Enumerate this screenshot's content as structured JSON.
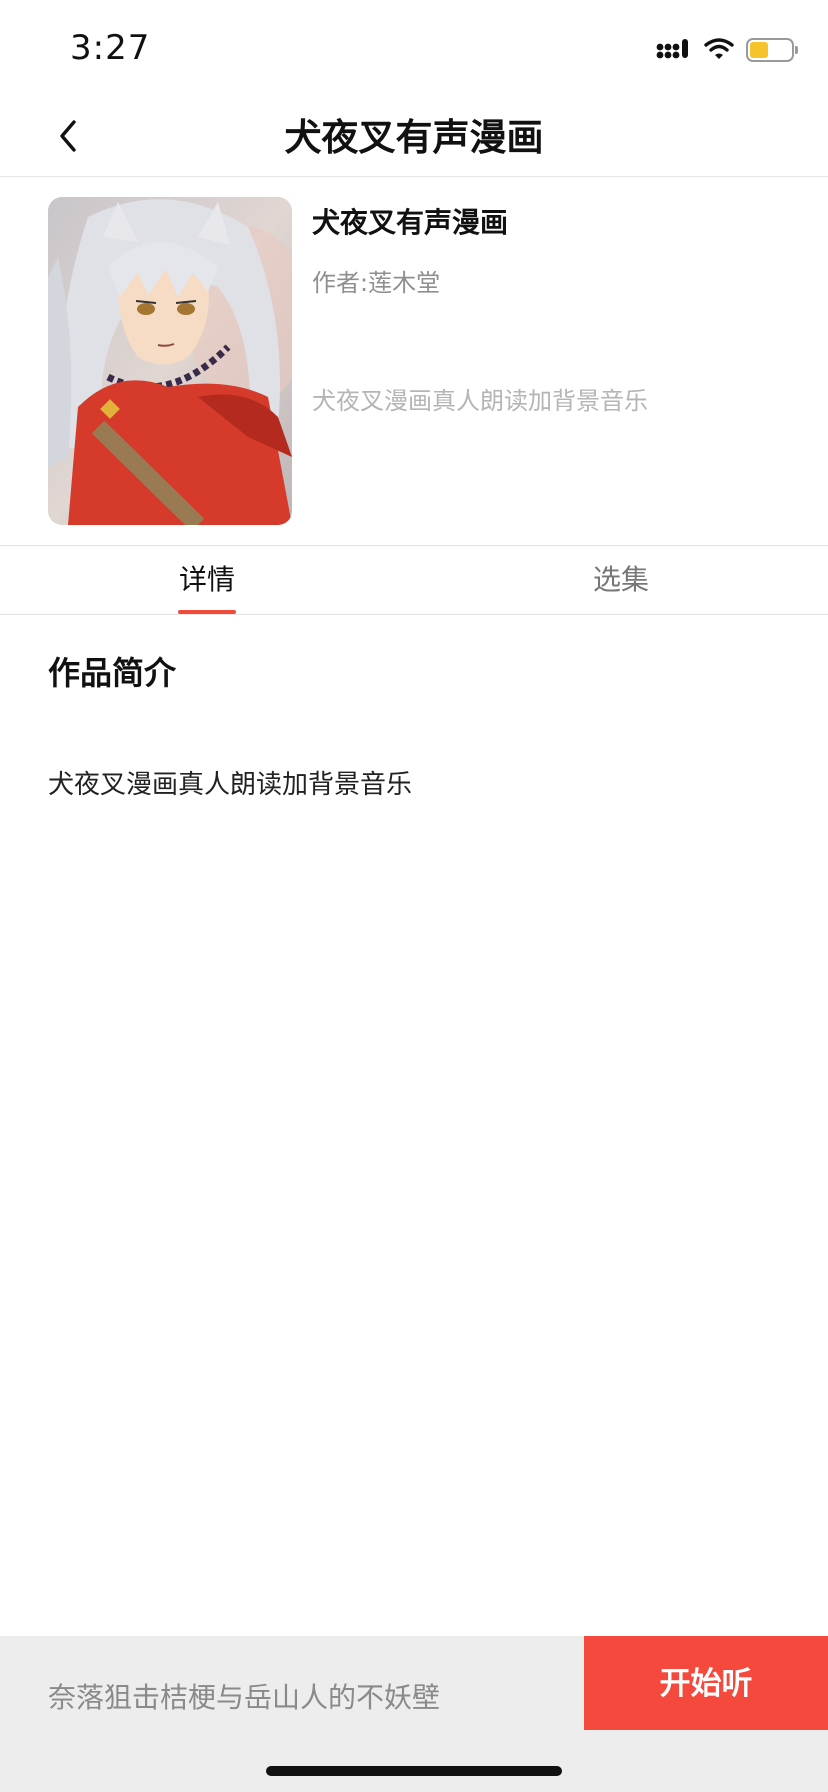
{
  "status_bar": {
    "time": "3:27",
    "icons": [
      "signal-icon",
      "wifi-icon",
      "battery-icon"
    ],
    "battery_level": 0.45,
    "battery_color": "#f5c32b"
  },
  "nav": {
    "back_icon": "chevron-left-icon",
    "title": "犬夜叉有声漫画"
  },
  "book": {
    "title": "犬夜叉有声漫画",
    "author": "作者:莲木堂",
    "description": "犬夜叉漫画真人朗读加背景音乐"
  },
  "tabs": [
    {
      "label": "详情",
      "active": true
    },
    {
      "label": "选集",
      "active": false
    }
  ],
  "intro": {
    "heading": "作品简介",
    "body": "犬夜叉漫画真人朗读加背景音乐"
  },
  "player": {
    "now_playing": "奈落狙击桔梗与岳山人的不妖壁",
    "start_label": "开始听"
  },
  "colors": {
    "accent": "#f04a3a",
    "start_button": "#f4493c",
    "bottom_bar": "#ededed"
  }
}
